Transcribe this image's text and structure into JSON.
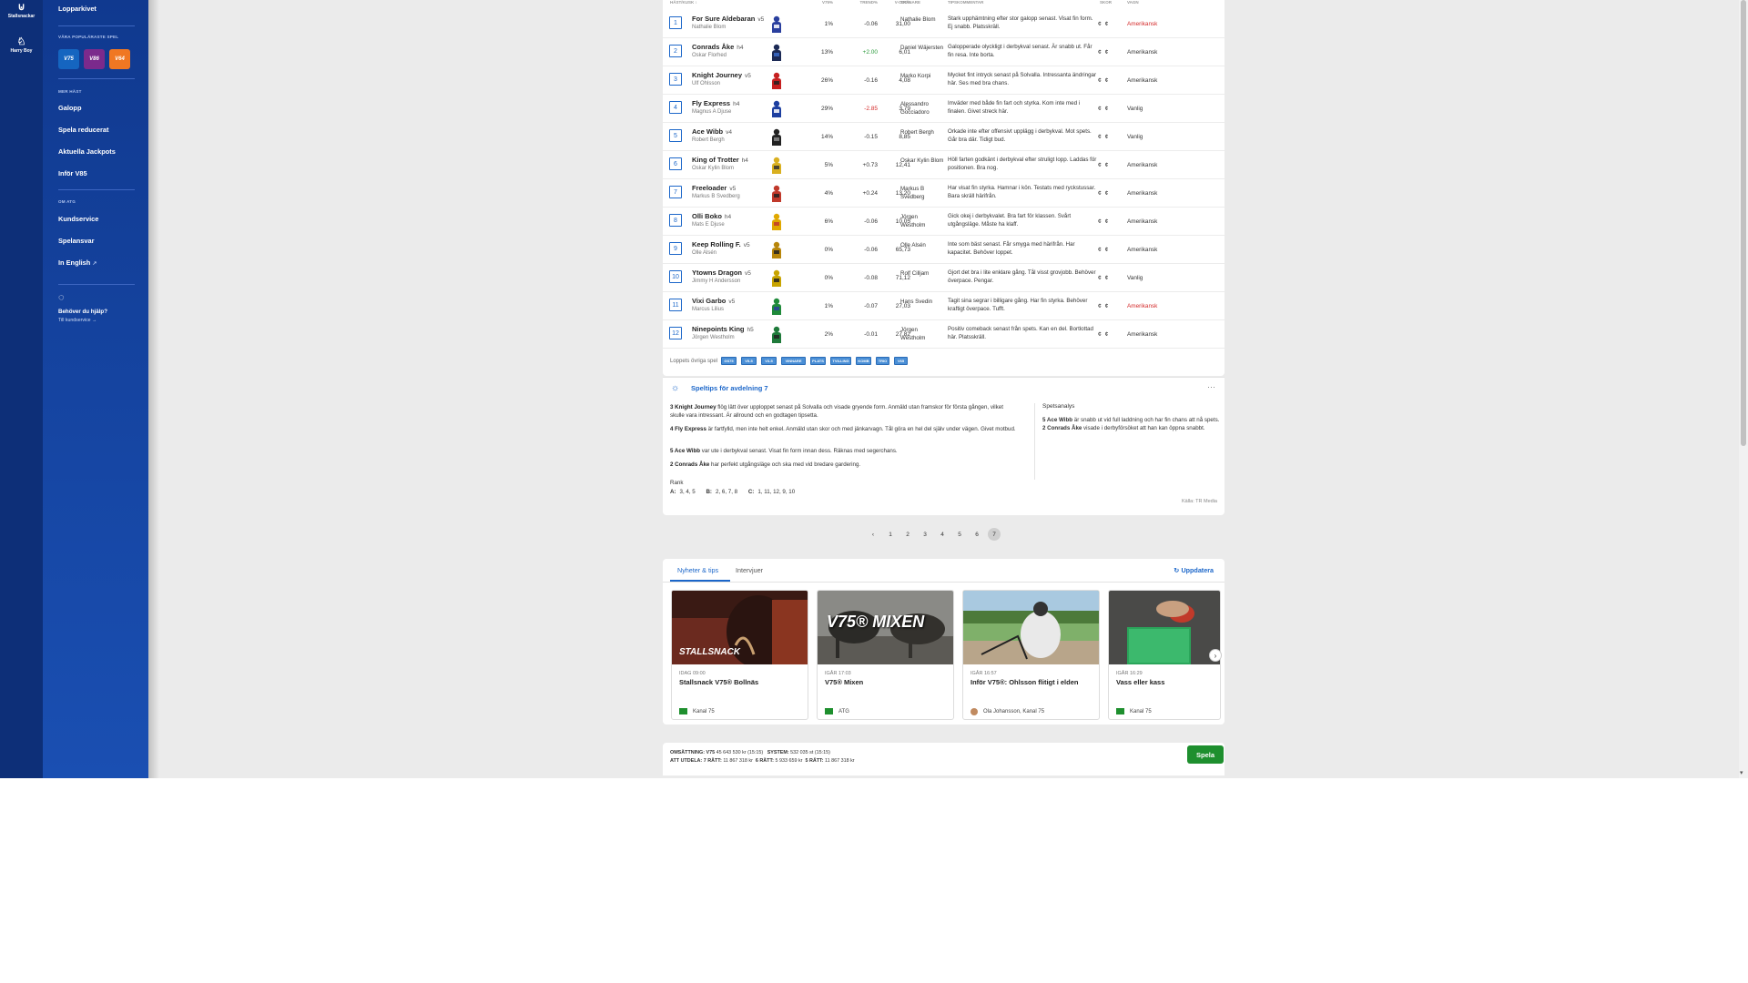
{
  "iconrail": {
    "items": [
      {
        "label": "Stallsnackar",
        "icon": "horseshoe-icon"
      },
      {
        "label": "Harry Boy",
        "icon": "harry-boy-icon"
      }
    ]
  },
  "sidebar": {
    "top_link": "Lopparkivet",
    "popular_heading": "VÅRA POPULÄRASTE SPEL",
    "games": [
      {
        "label": "V75",
        "color": "#1565c0"
      },
      {
        "label": "V86",
        "color": "#7b2a8c"
      },
      {
        "label": "V64",
        "color": "#f07722"
      }
    ],
    "next_heading": "MER HÄST",
    "next_links": [
      "Galopp",
      "Spela reducerat",
      "Aktuella Jackpots",
      "Inför V85"
    ],
    "about_heading": "OM ATG",
    "about_links": [
      "Kundservice",
      "Spelansvar",
      "In English"
    ],
    "help_title": "Behöver du hjälp?",
    "help_link": "Till kundservice →"
  },
  "startlist": {
    "headers": {
      "horse": "HÄST/KUSK ↕",
      "pct": "V75%",
      "trend": "TREND%",
      "odds": "V-ODDS",
      "trainer": "TRÄNARE",
      "comment": "TIPSKOMMENTAR",
      "shoes": "SKOR",
      "cart": "VAGN"
    },
    "rows": [
      {
        "num": "1",
        "name": "For Sure Aldebaran",
        "age": "v5",
        "driver": "Nathalie Blom",
        "pct": "1%",
        "trend": "-0.06",
        "trend_dir": "neg0",
        "odds": "31,00",
        "trainer": "Nathalie Blom",
        "comment": "Stark upphämtning efter stor galopp senast. Visat fin form. Ej snabb. Platsskräll.",
        "shoes": "¢ ¢",
        "cart": "Amerikansk",
        "cart_red": true,
        "colors": [
          "#2a3f9e",
          "#ffffff"
        ]
      },
      {
        "num": "2",
        "name": "Conrads Åke",
        "age": "h4",
        "driver": "Oskar Florhed",
        "pct": "13%",
        "trend": "+2.00",
        "trend_dir": "pos",
        "odds": "6,01",
        "trainer": "Daniel Wäjersten",
        "comment": "Galopperade olyckligt i derbykval senast. Är snabb ut. Får fin resa. Inte borta.",
        "shoes": "¢ ¢",
        "cart": "Amerikansk",
        "cart_red": false,
        "colors": [
          "#1c2a55",
          "#3a6bc9"
        ]
      },
      {
        "num": "3",
        "name": "Knight Journey",
        "age": "v5",
        "driver": "Ulf Ohlsson",
        "pct": "26%",
        "trend": "-0.16",
        "trend_dir": "neg0",
        "odds": "4,08",
        "trainer": "Marko Korpi",
        "comment": "Mycket fint intryck senast på Solvalla. Intressanta ändringar här. Ses med bra chans.",
        "shoes": "¢ ¢",
        "cart": "Amerikansk",
        "cart_red": false,
        "colors": [
          "#c62020",
          "#222222"
        ]
      },
      {
        "num": "4",
        "name": "Fly Express",
        "age": "h4",
        "driver": "Magnus A Djuse",
        "pct": "29%",
        "trend": "-2.85",
        "trend_dir": "neg",
        "odds": "3,79",
        "trainer": "Alessandro Gocciadoro",
        "comment": "Imväder med både fin fart och styrka. Kom inte med i finalen. Givet streck här.",
        "shoes": "¢ ¢",
        "cart": "Vanlig",
        "cart_red": false,
        "colors": [
          "#1d3fa0",
          "#ffffff"
        ]
      },
      {
        "num": "5",
        "name": "Ace Wibb",
        "age": "v4",
        "driver": "Robert Bergh",
        "pct": "14%",
        "trend": "-0.15",
        "trend_dir": "neg0",
        "odds": "8,85",
        "trainer": "Robert Bergh",
        "comment": "Orkade inte efter offensivt upplägg i derbykval. Mot spets. Går bra där. Tidigt bud.",
        "shoes": "¢ ¢",
        "cart": "Vanlig",
        "cart_red": false,
        "colors": [
          "#222222",
          "#888888"
        ]
      },
      {
        "num": "6",
        "name": "King of Trotter",
        "age": "h4",
        "driver": "Oskar Kylin Blom",
        "pct": "5%",
        "trend": "+0.73",
        "trend_dir": "neg0",
        "odds": "12,41",
        "trainer": "Oskar Kylin Blom",
        "comment": "Höll farten godkänt i derbykval efter struligt lopp. Laddas för positionen. Bra nog.",
        "shoes": "¢ ¢",
        "cart": "Amerikansk",
        "cart_red": false,
        "colors": [
          "#d9b020",
          "#333333"
        ]
      },
      {
        "num": "7",
        "name": "Freeloader",
        "age": "v5",
        "driver": "Markus B Svedberg",
        "pct": "4%",
        "trend": "+0.24",
        "trend_dir": "neg0",
        "odds": "13,20",
        "trainer": "Markus B Svedberg",
        "comment": "Har visat fin styrka. Hamnar i kön. Testats med ryckstussar. Bara skräll härifrån.",
        "shoes": "¢ ¢",
        "cart": "Amerikansk",
        "cart_red": false,
        "colors": [
          "#c0392b",
          "#222222"
        ]
      },
      {
        "num": "8",
        "name": "Olli Boko",
        "age": "h4",
        "driver": "Mats E Djuse",
        "pct": "6%",
        "trend": "-0.06",
        "trend_dir": "neg0",
        "odds": "10,05",
        "trainer": "Jörgen Westholm",
        "comment": "Gick okej i derbykvalet. Bra fart för klassen. Svårt utgångsläge. Måste ha klaff.",
        "shoes": "¢ ¢",
        "cart": "Amerikansk",
        "cart_red": false,
        "colors": [
          "#e0a800",
          "#c0392b"
        ]
      },
      {
        "num": "9",
        "name": "Keep Rolling F.",
        "age": "v5",
        "driver": "Olle Alsén",
        "pct": "0%",
        "trend": "-0.06",
        "trend_dir": "neg0",
        "odds": "65,73",
        "trainer": "Olle Alsén",
        "comment": "Inte som bäst senast. Får smyga med härifrån. Har kapacitet. Behöver loppet.",
        "shoes": "¢ ¢",
        "cart": "Amerikansk",
        "cart_red": false,
        "colors": [
          "#b8860b",
          "#222222"
        ]
      },
      {
        "num": "10",
        "name": "Ytowns Dragon",
        "age": "v5",
        "driver": "Jimmy H Andersson",
        "pct": "0%",
        "trend": "-0.08",
        "trend_dir": "neg0",
        "odds": "71,12",
        "trainer": "Rolf Cilljam",
        "comment": "Gjort det bra i lite enklare gång. Tål visst grovjobb. Behöver överpace. Pengar.",
        "shoes": "¢ ¢",
        "cart": "Vanlig",
        "cart_red": false,
        "colors": [
          "#c8a400",
          "#222222"
        ]
      },
      {
        "num": "11",
        "name": "Vixi Garbo",
        "age": "v5",
        "driver": "Marcus Lilius",
        "pct": "1%",
        "trend": "-0.07",
        "trend_dir": "neg0",
        "odds": "27,03",
        "trainer": "Hans Svedin",
        "comment": "Tagit sina segrar i billigare gång. Har fin styrka. Behöver kraftigt överpace. Tufft.",
        "shoes": "¢ ¢",
        "cart": "Amerikansk",
        "cart_red": true,
        "colors": [
          "#1f8a3a",
          "#2a3f9e"
        ]
      },
      {
        "num": "12",
        "name": "Ninepoints King",
        "age": "h5",
        "driver": "Jörgen Westholm",
        "pct": "2%",
        "trend": "-0.01",
        "trend_dir": "neg0",
        "odds": "27,82",
        "trainer": "Jörgen Westholm",
        "comment": "Positiv comeback senast från spets. Kan en del. Bortlottad här. Platsskräll.",
        "shoes": "¢ ¢",
        "cart": "Amerikansk",
        "cart_red": false,
        "colors": [
          "#1f7a3a",
          "#222222"
        ]
      }
    ],
    "other_games_label": "Loppets övriga spel",
    "other_games": [
      "GS75",
      "V5-5",
      "V3-5",
      "VINNARE",
      "PLATS",
      "TVILLING",
      "KOMB",
      "TRIO",
      "V65"
    ]
  },
  "tips": {
    "title": "Speltips för avdelning 7",
    "more": "···",
    "paragraphs": [
      {
        "lead": "3 Knight Journey",
        "text": " flög lätt över upploppet senast på Solvalla och visade gryende form. Anmäld utan framskor för första gången, vilket skulle vara intressant. Är allround och en godtagen tipsetta."
      },
      {
        "lead": "4 Fly Express",
        "text": " är fartfylld, men inte helt enkel. Anmäld utan skor och med jänkarvagn. Tål göra en hel del själv under vägen. Givet motbud."
      },
      {
        "lead": "5 Ace Wibb",
        "text": " var ute i derbykval senast. Visat fin form innan dess. Räknas med segerchans."
      },
      {
        "lead": "2 Conrads Åke",
        "text": " har perfekt utgångsläge och ska med vid bredare gardering."
      }
    ],
    "spets_title": "Spetsanalys",
    "spets_lead1": "5 Ace Wibb",
    "spets_text1": " är snabb ut vid full laddning och har fin chans att nå spets. ",
    "spets_lead2": "2 Conrads Åke",
    "spets_text2": " visade i derbyförsöket att han kan öppna snabbt.",
    "rank_title": "Rank",
    "rank": [
      {
        "label": "A:",
        "value": "3, 4, 5"
      },
      {
        "label": "B:",
        "value": "2, 6, 7, 8"
      },
      {
        "label": "C:",
        "value": "1, 11, 12, 9, 10"
      }
    ],
    "source": "Källa: TR Media"
  },
  "pagination": {
    "prev": "‹",
    "pages": [
      "1",
      "2",
      "3",
      "4",
      "5",
      "6",
      "7"
    ],
    "current": "7"
  },
  "news": {
    "tabs": [
      "Nyheter & tips",
      "Intervjuer"
    ],
    "active_tab": "Nyheter & tips",
    "refresh": "Uppdatera",
    "cards": [
      {
        "date": "IDAG 09:00",
        "title": "Stallsnack V75® Bollnäs",
        "source": "Kanal 75",
        "overlay": "STALLSNACK"
      },
      {
        "date": "IGÅR 17:03",
        "title": "V75® Mixen",
        "source": "ATG",
        "overlay": "V75® MIXEN"
      },
      {
        "date": "IGÅR 16:57",
        "title": "Inför V75®: Ohlsson flitigt i elden",
        "source": "Ola Johansson, Kanal 75",
        "overlay": ""
      },
      {
        "date": "IGÅR 16:29",
        "title": "Vass eller kass",
        "source": "Kanal 75",
        "overlay": ""
      }
    ],
    "next": "›"
  },
  "playbar": {
    "line1_turnover_label": "OMSÄTTNING:",
    "line1_turnover_game": "V75",
    "line1_turnover_value": "45 643 530 kr",
    "line1_turnover_time": "(15:15)",
    "line1_system_label": "SYSTEM:",
    "line1_system_value": "532 035 st",
    "line1_system_time": "(15:15)",
    "line2_label": "ATT UTDELA:",
    "line2_7": "7 RÄTT:",
    "line2_7_value": "11 867 318 kr",
    "line2_6": "6 RÄTT:",
    "line2_6_value": "5 933 659 kr",
    "line2_5": "5 RÄTT:",
    "line2_5_value": "11 867 318 kr",
    "play_button": "Spela"
  }
}
